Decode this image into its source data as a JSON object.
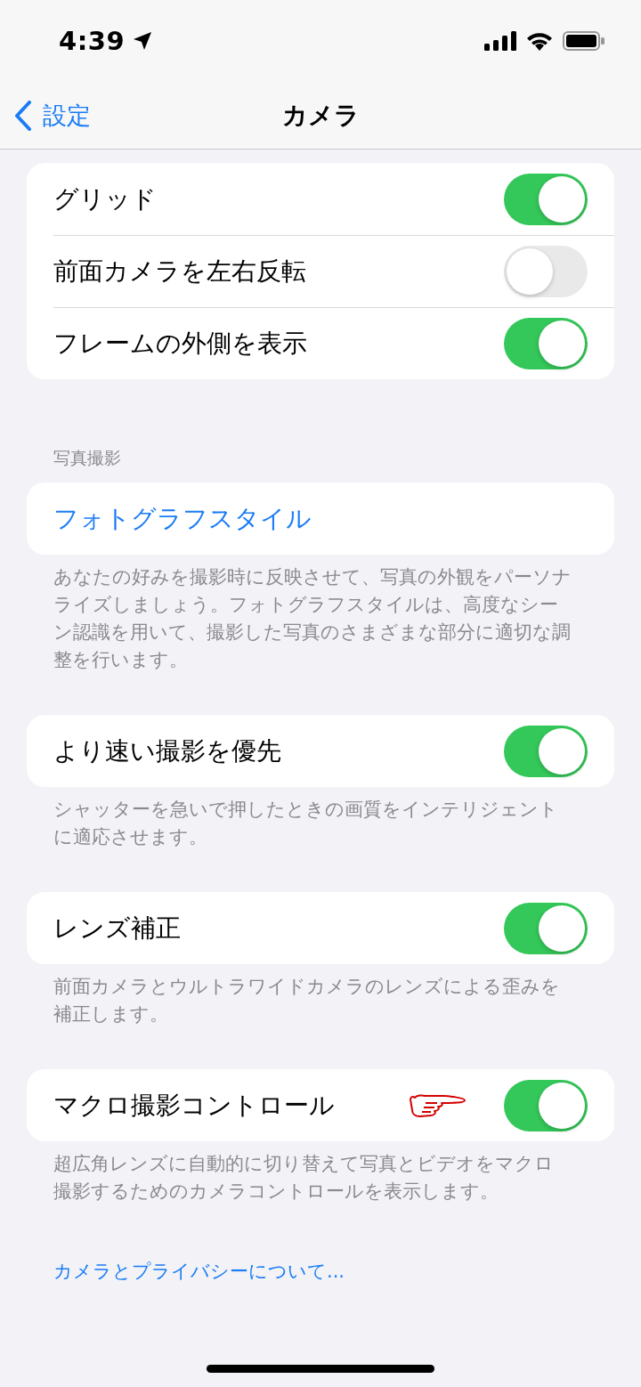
{
  "status_bar": {
    "time": "4:39"
  },
  "nav": {
    "back": "設定",
    "title": "カメラ"
  },
  "sections": [
    {
      "rows": [
        {
          "kind": "toggle",
          "label": "グリッド",
          "on": true
        },
        {
          "kind": "toggle",
          "label": "前面カメラを左右反転",
          "on": false
        },
        {
          "kind": "toggle",
          "label": "フレームの外側を表示",
          "on": true
        }
      ]
    },
    {
      "header": "写真撮影",
      "rows": [
        {
          "kind": "link",
          "label": "フォトグラフスタイル"
        }
      ],
      "footer": "あなたの好みを撮影時に反映させて、写真の外観をパーソナライズしましょう。フォトグラフスタイルは、高度なシーン認識を用いて、撮影した写真のさまざまな部分に適切な調整を行います。"
    },
    {
      "rows": [
        {
          "kind": "toggle",
          "label": "より速い撮影を優先",
          "on": true
        }
      ],
      "footer": "シャッターを急いで押したときの画質をインテリジェントに適応させます。"
    },
    {
      "rows": [
        {
          "kind": "toggle",
          "label": "レンズ補正",
          "on": true
        }
      ],
      "footer": "前面カメラとウルトラワイドカメラのレンズによる歪みを補正します。"
    },
    {
      "rows": [
        {
          "kind": "toggle",
          "label": "マクロ撮影コントロール",
          "on": true,
          "pointer": true
        }
      ],
      "footer": "超広角レンズに自動的に切り替えて写真とビデオをマクロ撮影するためのカメラコントロールを表示します。"
    }
  ],
  "link": "カメラとプライバシーについて..."
}
